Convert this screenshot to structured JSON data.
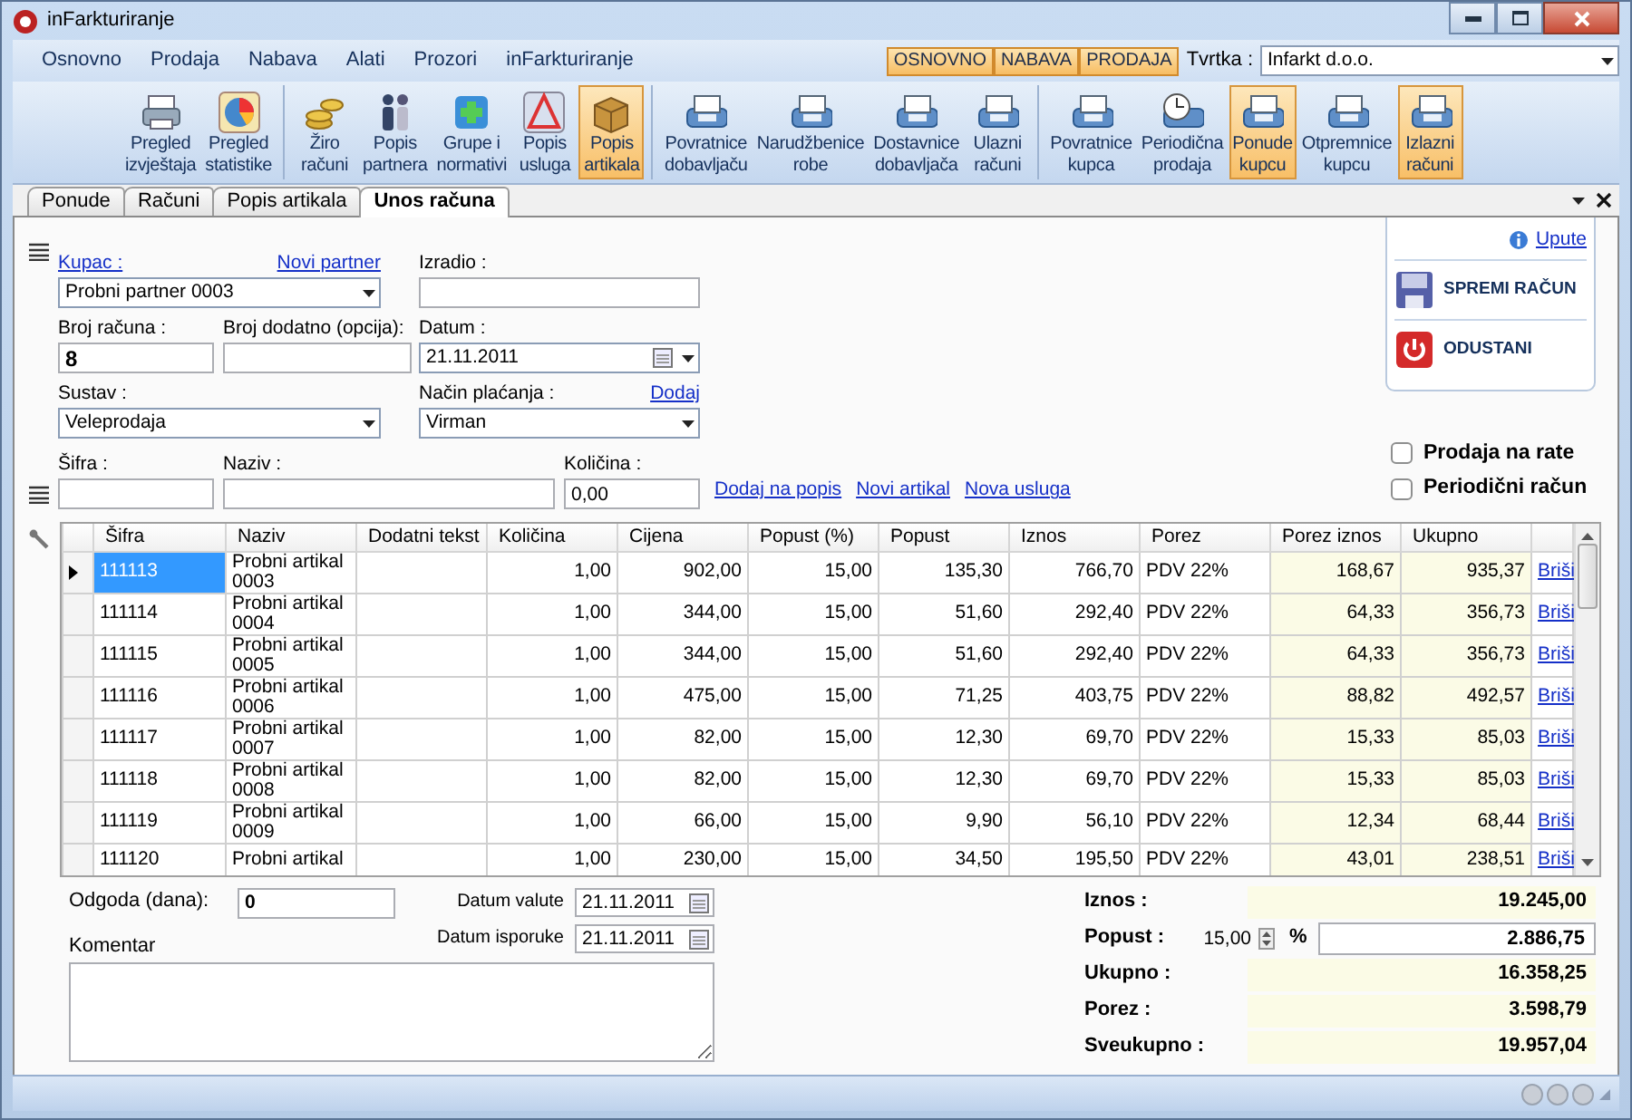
{
  "window": {
    "title": "inFarkturiranje"
  },
  "menu": [
    {
      "label": "Osnovno"
    },
    {
      "label": "Prodaja"
    },
    {
      "label": "Nabava"
    },
    {
      "label": "Alati"
    },
    {
      "label": "Prozori"
    },
    {
      "label": "inFarkturiranje"
    }
  ],
  "module_buttons": [
    {
      "label": "OSNOVNO"
    },
    {
      "label": "NABAVA"
    },
    {
      "label": "PRODAJA"
    }
  ],
  "company": {
    "label": "Tvrtka :",
    "value": "Infarkt d.o.o."
  },
  "ribbon": [
    {
      "buttons": [
        {
          "lines": [
            "Pregled",
            "izvještaja"
          ],
          "selected": false
        },
        {
          "lines": [
            "Pregled",
            "statistike"
          ],
          "selected": false
        }
      ]
    },
    {
      "buttons": [
        {
          "lines": [
            "Žiro",
            "računi"
          ],
          "selected": false
        },
        {
          "lines": [
            "Popis",
            "partnera"
          ],
          "selected": false
        },
        {
          "lines": [
            "Grupe i",
            "normativi"
          ],
          "selected": false
        },
        {
          "lines": [
            "Popis",
            "usluga"
          ],
          "selected": false
        },
        {
          "lines": [
            "Popis",
            "artikala"
          ],
          "selected": true
        }
      ]
    },
    {
      "buttons": [
        {
          "lines": [
            "Povratnice",
            "dobavljaču"
          ],
          "selected": false
        },
        {
          "lines": [
            "Narudžbenice",
            "robe"
          ],
          "selected": false
        },
        {
          "lines": [
            "Dostavnice",
            "dobavljača"
          ],
          "selected": false
        },
        {
          "lines": [
            "Ulazni",
            "računi"
          ],
          "selected": false
        }
      ]
    },
    {
      "buttons": [
        {
          "lines": [
            "Povratnice",
            "kupca"
          ],
          "selected": false
        },
        {
          "lines": [
            "Periodična",
            "prodaja"
          ],
          "selected": false
        },
        {
          "lines": [
            "Ponude",
            "kupcu"
          ],
          "selected": true
        },
        {
          "lines": [
            "Otpremnice",
            "kupcu"
          ],
          "selected": false
        },
        {
          "lines": [
            "Izlazni",
            "računi"
          ],
          "selected": true
        }
      ]
    }
  ],
  "tabs": [
    {
      "label": "Ponude",
      "selected": false
    },
    {
      "label": "Računi",
      "selected": false
    },
    {
      "label": "Popis artikala",
      "selected": false
    },
    {
      "label": "Unos računa",
      "selected": true
    }
  ],
  "form": {
    "customer": {
      "label": "Kupac :",
      "link": "Novi partner",
      "value": "Probni partner 0003"
    },
    "created_by": {
      "label": "Izradio :"
    },
    "invoice_number": {
      "label": "Broj računa :",
      "value": "8"
    },
    "extra_number": {
      "label": "Broj dodatno (opcija):"
    },
    "date": {
      "label": "Datum :",
      "value": "21.11.2011"
    },
    "system": {
      "label": "Sustav :",
      "value": "Veleprodaja"
    },
    "payment": {
      "label": "Način plaćanja :",
      "link": "Dodaj",
      "value": "Virman"
    },
    "code": {
      "label": "Šifra :"
    },
    "name": {
      "label": "Naziv :"
    },
    "quantity": {
      "label": "Količina :",
      "value": "0,00"
    },
    "links": [
      "Dodaj na popis",
      "Novi artikal",
      "Nova usluga"
    ]
  },
  "actions": {
    "help": "Upute",
    "save": "SPREMI RAČUN",
    "cancel": "ODUSTANI"
  },
  "options": [
    {
      "label": "Prodaja na rate",
      "checked": false
    },
    {
      "label": "Periodični račun",
      "checked": false
    }
  ],
  "table": {
    "columns": [
      {
        "label": "Šifra",
        "kind": "text"
      },
      {
        "label": "Naziv",
        "kind": "text"
      },
      {
        "label": "Dodatni tekst",
        "kind": "text"
      },
      {
        "label": "Količina",
        "kind": "number"
      },
      {
        "label": "Cijena",
        "kind": "number"
      },
      {
        "label": "Popust (%)",
        "kind": "number"
      },
      {
        "label": "Popust",
        "kind": "number"
      },
      {
        "label": "Iznos",
        "kind": "number"
      },
      {
        "label": "Porez",
        "kind": "text"
      },
      {
        "label": "Porez iznos",
        "kind": "total"
      },
      {
        "label": "Ukupno",
        "kind": "total"
      }
    ],
    "rows": [
      {
        "selected": true,
        "cells": [
          "111113",
          "Probni artikal 0003",
          "",
          "1,00",
          "902,00",
          "15,00",
          "135,30",
          "766,70",
          "PDV 22%",
          "168,67",
          "935,37"
        ],
        "action": "Briši"
      },
      {
        "selected": false,
        "cells": [
          "111114",
          "Probni artikal 0004",
          "",
          "1,00",
          "344,00",
          "15,00",
          "51,60",
          "292,40",
          "PDV 22%",
          "64,33",
          "356,73"
        ],
        "action": "Briši"
      },
      {
        "selected": false,
        "cells": [
          "111115",
          "Probni artikal 0005",
          "",
          "1,00",
          "344,00",
          "15,00",
          "51,60",
          "292,40",
          "PDV 22%",
          "64,33",
          "356,73"
        ],
        "action": "Briši"
      },
      {
        "selected": false,
        "cells": [
          "111116",
          "Probni artikal 0006",
          "",
          "1,00",
          "475,00",
          "15,00",
          "71,25",
          "403,75",
          "PDV 22%",
          "88,82",
          "492,57"
        ],
        "action": "Briši"
      },
      {
        "selected": false,
        "cells": [
          "111117",
          "Probni artikal 0007",
          "",
          "1,00",
          "82,00",
          "15,00",
          "12,30",
          "69,70",
          "PDV 22%",
          "15,33",
          "85,03"
        ],
        "action": "Briši"
      },
      {
        "selected": false,
        "cells": [
          "111118",
          "Probni artikal 0008",
          "",
          "1,00",
          "82,00",
          "15,00",
          "12,30",
          "69,70",
          "PDV 22%",
          "15,33",
          "85,03"
        ],
        "action": "Briši"
      },
      {
        "selected": false,
        "cells": [
          "111119",
          "Probni artikal 0009",
          "",
          "1,00",
          "66,00",
          "15,00",
          "9,90",
          "56,10",
          "PDV 22%",
          "12,34",
          "68,44"
        ],
        "action": "Briši"
      },
      {
        "selected": false,
        "cells": [
          "111120",
          "Probni artikal",
          "",
          "1,00",
          "230,00",
          "15,00",
          "34,50",
          "195,50",
          "PDV 22%",
          "43,01",
          "238,51"
        ],
        "action": "Briši"
      }
    ]
  },
  "bottom": {
    "delay": {
      "label": "Odgoda (dana):",
      "value": "0"
    },
    "value_date": {
      "label": "Datum valute",
      "value": "21.11.2011"
    },
    "delivery_date": {
      "label": "Datum isporuke",
      "value": "21.11.2011"
    },
    "comment": {
      "label": "Komentar"
    }
  },
  "summary": [
    {
      "kind": "total",
      "label": "Iznos :",
      "value": "19.245,00"
    },
    {
      "kind": "discount",
      "label": "Popust :",
      "percent": "15,00",
      "unit": "%",
      "value": "2.886,75"
    },
    {
      "kind": "total",
      "label": "Ukupno :",
      "value": "16.358,25"
    },
    {
      "kind": "total",
      "label": "Porez :",
      "value": "3.598,79"
    },
    {
      "kind": "total",
      "label": "Sveukupno :",
      "value": "19.957,04"
    }
  ]
}
